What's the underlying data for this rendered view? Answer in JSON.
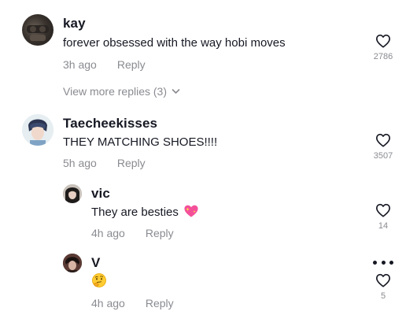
{
  "comments": [
    {
      "username": "kay",
      "text": "forever obsessed with the way hobi moves",
      "time": "3h ago",
      "reply_label": "Reply",
      "likes": "2786"
    },
    {
      "username": "Taecheekisses",
      "text": "THEY MATCHING SHOES!!!!",
      "time": "5h ago",
      "reply_label": "Reply",
      "likes": "3507"
    }
  ],
  "replies": [
    {
      "username": "vic",
      "text": "They are besties",
      "emoji": "sparkling-heart",
      "time": "4h ago",
      "reply_label": "Reply",
      "likes": "14"
    },
    {
      "username": "V",
      "emoji": "thinking-face",
      "time": "4h ago",
      "reply_label": "Reply",
      "likes": "5"
    }
  ],
  "view_more": "View more replies (3)",
  "icons": {
    "like": "heart-outline-icon",
    "expand": "chevron-down-icon",
    "more": "more-options-icon"
  },
  "colors": {
    "text": "#161823",
    "muted": "#8a8b91"
  }
}
